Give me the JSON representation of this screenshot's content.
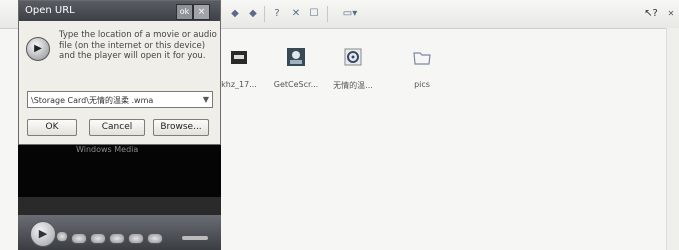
{
  "explorer": {
    "toolbar_icons": [
      "back-icon",
      "forward-icon",
      "help-icon",
      "delete-icon",
      "properties-icon",
      "view-menu-icon",
      "whats-this-icon",
      "collapse-icon"
    ],
    "files": [
      {
        "label": "khz_17...",
        "icon": "video-file-icon"
      },
      {
        "label": "GetCeScr...",
        "icon": "program-icon"
      },
      {
        "label": "无情的温...",
        "icon": "audio-file-icon"
      },
      {
        "label": "pics",
        "icon": "folder-icon"
      }
    ]
  },
  "dialog": {
    "title": "Open URL",
    "title_ok": "ok",
    "title_close": "×",
    "message": "Type the location of a movie or audio file (on the internet or this device) and the player will open it for you.",
    "url_value": "\\Storage Card\\无情的温柔 .wma",
    "ok_label": "OK",
    "cancel_label": "Cancel",
    "browse_label": "Browse..."
  },
  "player": {
    "overlay_text": "Windows Media"
  }
}
